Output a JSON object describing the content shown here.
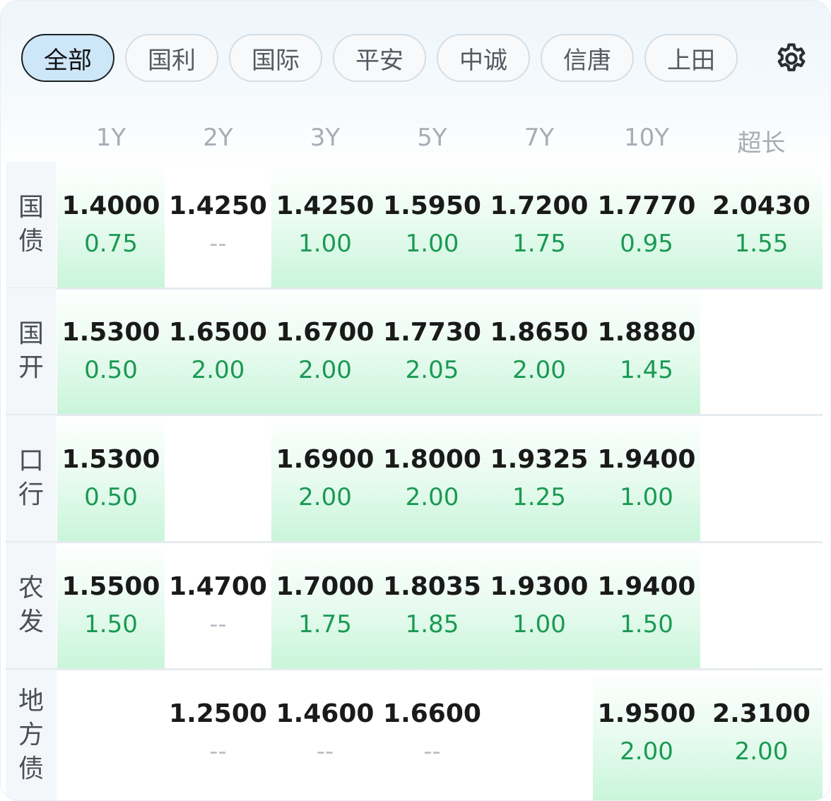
{
  "tabs": [
    "全部",
    "国利",
    "国际",
    "平安",
    "中诚",
    "信唐",
    "上田"
  ],
  "active_tab": "全部",
  "settings_icon": "gear-icon",
  "colors": {
    "positive": "#1a9a52",
    "highlight": "#c9f5da",
    "active_tab_bg": "#cde6f8"
  },
  "tenors": [
    "1Y",
    "2Y",
    "3Y",
    "5Y",
    "7Y",
    "10Y",
    "超长"
  ],
  "rows": [
    {
      "label": [
        "国",
        "债"
      ],
      "cells": [
        {
          "value": "1.4000",
          "change": "0.75",
          "hl": true
        },
        {
          "value": "1.4250",
          "change": "--",
          "hl": false
        },
        {
          "value": "1.4250",
          "change": "1.00",
          "hl": true
        },
        {
          "value": "1.5950",
          "change": "1.00",
          "hl": true
        },
        {
          "value": "1.7200",
          "change": "1.75",
          "hl": true
        },
        {
          "value": "1.7770",
          "change": "0.95",
          "hl": true
        },
        {
          "value": "2.0430",
          "change": "1.55",
          "hl": true
        }
      ]
    },
    {
      "label": [
        "国",
        "开"
      ],
      "cells": [
        {
          "value": "1.5300",
          "change": "0.50",
          "hl": true
        },
        {
          "value": "1.6500",
          "change": "2.00",
          "hl": true
        },
        {
          "value": "1.6700",
          "change": "2.00",
          "hl": true
        },
        {
          "value": "1.7730",
          "change": "2.05",
          "hl": true
        },
        {
          "value": "1.8650",
          "change": "2.00",
          "hl": true
        },
        {
          "value": "1.8880",
          "change": "1.45",
          "hl": true
        },
        null
      ]
    },
    {
      "label": [
        "口",
        "行"
      ],
      "cells": [
        {
          "value": "1.5300",
          "change": "0.50",
          "hl": true
        },
        null,
        {
          "value": "1.6900",
          "change": "2.00",
          "hl": true
        },
        {
          "value": "1.8000",
          "change": "2.00",
          "hl": true
        },
        {
          "value": "1.9325",
          "change": "1.25",
          "hl": true
        },
        {
          "value": "1.9400",
          "change": "1.00",
          "hl": true
        },
        null
      ]
    },
    {
      "label": [
        "农",
        "发"
      ],
      "cells": [
        {
          "value": "1.5500",
          "change": "1.50",
          "hl": true
        },
        {
          "value": "1.4700",
          "change": "--",
          "hl": false
        },
        {
          "value": "1.7000",
          "change": "1.75",
          "hl": true
        },
        {
          "value": "1.8035",
          "change": "1.85",
          "hl": true
        },
        {
          "value": "1.9300",
          "change": "1.00",
          "hl": true
        },
        {
          "value": "1.9400",
          "change": "1.50",
          "hl": true
        },
        null
      ]
    },
    {
      "label": [
        "地",
        "方",
        "债"
      ],
      "cells": [
        null,
        {
          "value": "1.2500",
          "change": "--",
          "hl": false
        },
        {
          "value": "1.4600",
          "change": "--",
          "hl": false
        },
        {
          "value": "1.6600",
          "change": "--",
          "hl": false
        },
        null,
        {
          "value": "1.9500",
          "change": "2.00",
          "hl": true
        },
        {
          "value": "2.3100",
          "change": "2.00",
          "hl": true
        }
      ]
    }
  ]
}
